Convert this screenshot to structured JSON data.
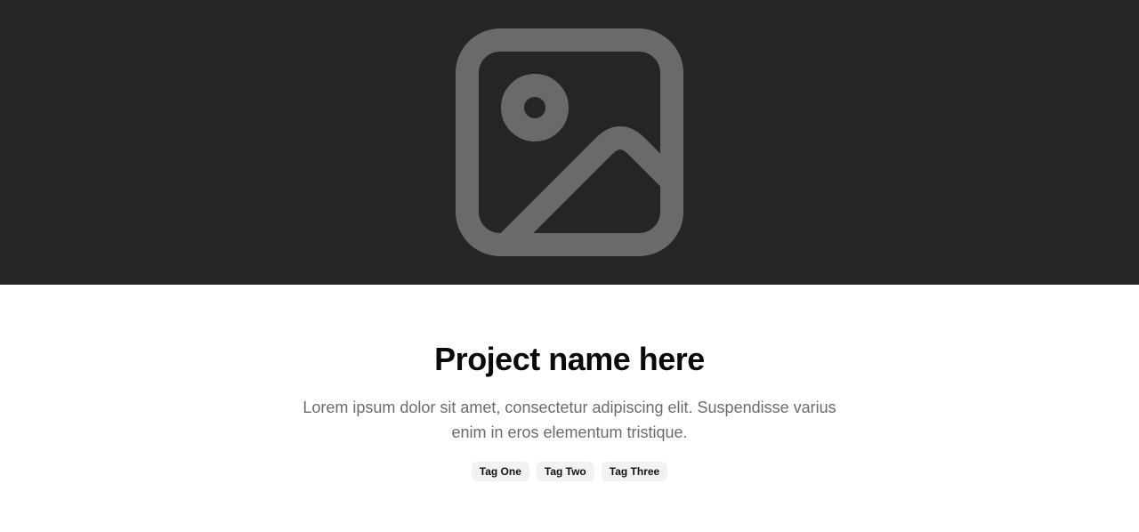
{
  "hero": {
    "icon": "image-placeholder-icon",
    "background_color": "#252525",
    "icon_color": "#6a6a6a"
  },
  "project": {
    "title": "Project name here",
    "description": "Lorem ipsum dolor sit amet, consectetur adipiscing elit. Suspendisse varius enim in eros elementum tristique.",
    "tags": [
      "Tag One",
      "Tag Two",
      "Tag Three"
    ]
  },
  "colors": {
    "title": "#0a0a0a",
    "description": "#6b6b6b",
    "tag_background": "#f2f2f2"
  }
}
